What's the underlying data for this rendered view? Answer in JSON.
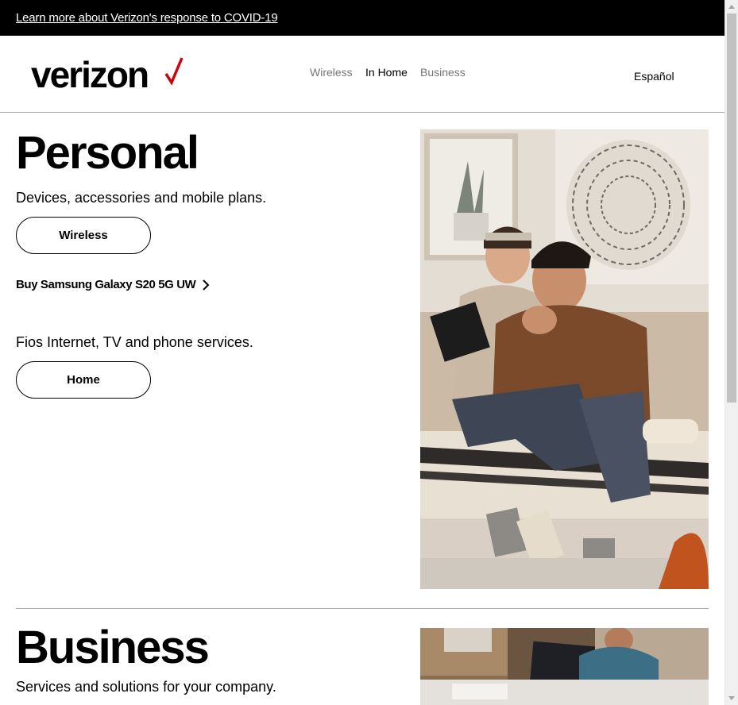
{
  "banner": {
    "link_text": "Learn more about Verizon's response to COVID-19"
  },
  "header": {
    "logo_text": "verizon",
    "nav": [
      {
        "label": "Wireless"
      },
      {
        "label": "In Home"
      },
      {
        "label": "Business"
      }
    ],
    "active_nav": "In Home",
    "language_link": "Español"
  },
  "personal": {
    "title": "Personal",
    "wireless_description": "Devices, accessories and mobile plans.",
    "wireless_button": "Wireless",
    "promo_link": "Buy Samsung Galaxy S20 5G UW",
    "home_description": "Fios Internet, TV and phone services.",
    "home_button": "Home"
  },
  "business": {
    "title": "Business",
    "description": "Services and solutions for your company."
  },
  "colors": {
    "brand_red": "#cd040b",
    "banner_bg": "#000000",
    "nav_inactive": "#747676",
    "divider": "#a7a7a7"
  },
  "icons": {
    "logo_check": "checkmark-icon",
    "promo_arrow": "chevron-right-icon"
  }
}
